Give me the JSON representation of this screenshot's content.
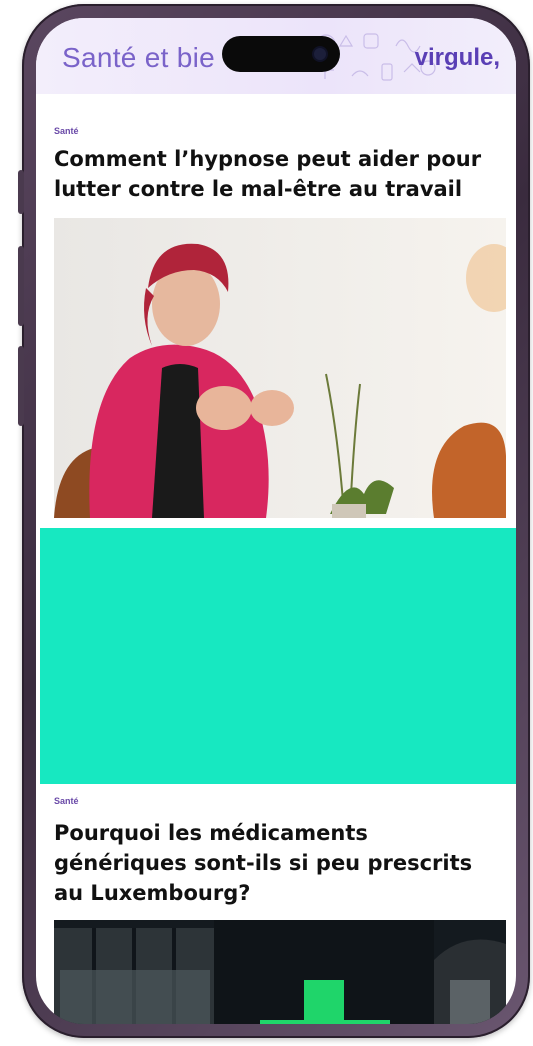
{
  "header": {
    "section_title": "Santé et bie",
    "brand": "virgule,"
  },
  "articles": [
    {
      "category": "Santé",
      "title": "Comment l’hypnose peut aider pour lutter contre le mal-être au travail",
      "image_alt": "Woman in pink blazer gesturing while speaking"
    },
    {
      "category": "Santé",
      "title": "Pourquoi les médicaments génériques sont-ils si peu prescrits au Luxembourg?",
      "image_alt": "Pharmacy storefront at night"
    }
  ],
  "ad": {
    "color": "#17e8c1"
  },
  "colors": {
    "accent": "#6a4aa8",
    "header_bg": "#ece4fa"
  }
}
